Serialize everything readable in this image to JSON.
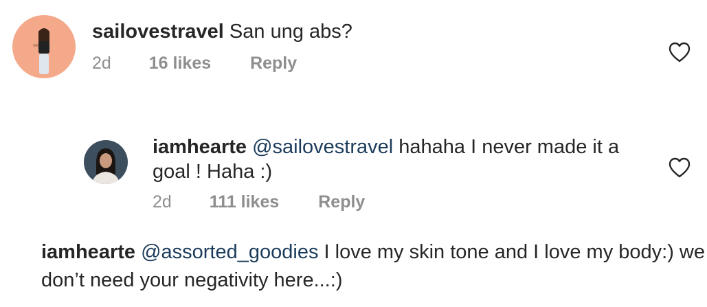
{
  "comments": [
    {
      "username": "sailovestravel",
      "text": " San ung abs?",
      "time": "2d",
      "likes": "16 likes",
      "reply_label": "Reply"
    },
    {
      "username": "iamhearte",
      "mention": "@sailovestravel",
      "text_line1": " hahaha I never made it a",
      "text_line2": "goal ! Haha :)",
      "time": "2d",
      "likes": "111 likes",
      "reply_label": "Reply"
    },
    {
      "username": "iamhearte",
      "mention": "@assorted_goodies",
      "text_line1": " I love my skin tone and I love my body:) we",
      "text_line2": "don’t need your negativity here...:)"
    }
  ],
  "icons": {
    "like": "heart-outline-icon"
  },
  "colors": {
    "username": "#262626",
    "mention": "#1b3b5b",
    "meta": "#8e8e8e",
    "avatar1_bg": "#f4a98a"
  }
}
